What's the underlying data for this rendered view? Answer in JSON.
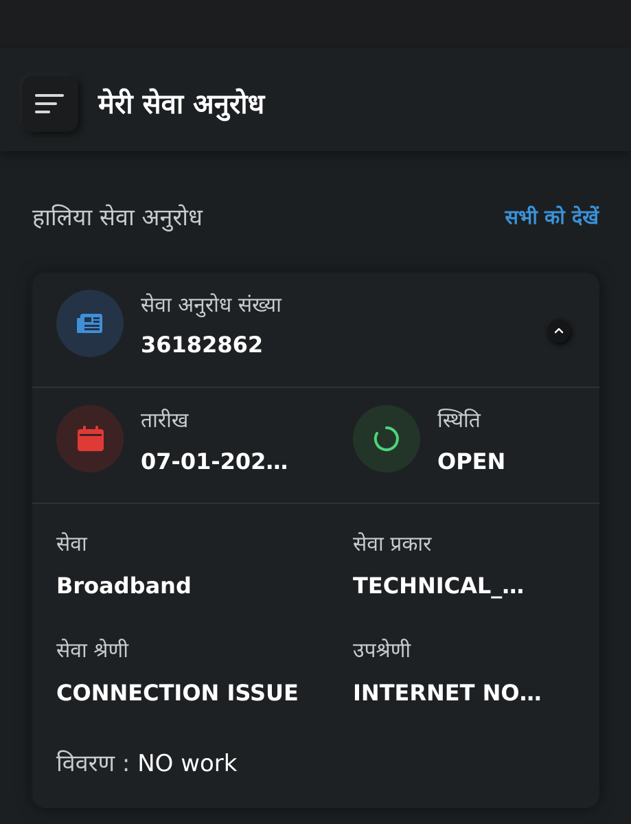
{
  "header": {
    "title": "मेरी सेवा अनुरोध"
  },
  "section": {
    "title": "हालिया सेवा अनुरोध",
    "view_all": "सभी को देखें"
  },
  "request": {
    "number_label": "सेवा अनुरोध संख्या",
    "number_value": "36182862",
    "date_label": "तारीख",
    "date_value": "07-01-202…",
    "status_label": "स्थिति",
    "status_value": "OPEN",
    "service_label": "सेवा",
    "service_value": "Broadband",
    "service_type_label": "सेवा प्रकार",
    "service_type_value": "TECHNICAL_…",
    "category_label": "सेवा श्रेणी",
    "category_value": "CONNECTION ISSUE",
    "subcategory_label": "उपश्रेणी",
    "subcategory_value": "INTERNET NO…",
    "description_label": "विवरण :",
    "description_value": "NO work"
  },
  "icons": {
    "menu": "menu-icon",
    "request": "newspaper-icon",
    "date": "calendar-icon",
    "status": "progress-ring-icon",
    "collapse": "chevron-up-icon"
  },
  "colors": {
    "accent_link": "#3a92d8",
    "request_icon": "#3f8fd9",
    "date_icon": "#e03a36",
    "status_icon": "#4fd37c"
  }
}
